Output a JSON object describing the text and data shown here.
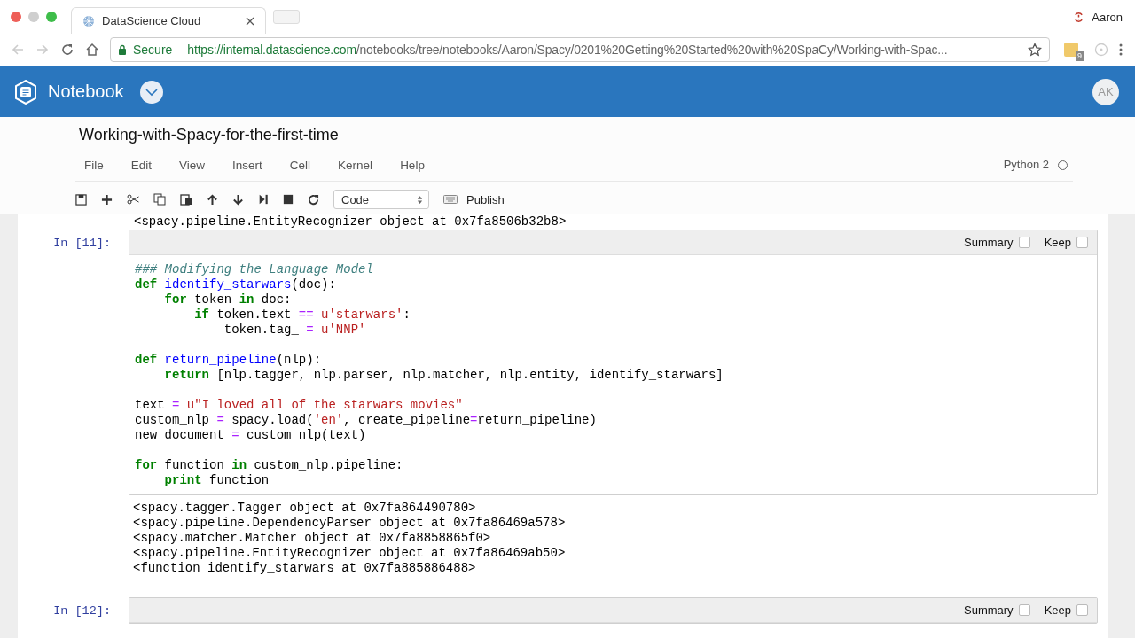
{
  "browser": {
    "tab_title": "DataScience Cloud",
    "user_name": "Aaron",
    "secure_label": "Secure",
    "url_host": "https://internal.datascience.com",
    "url_path": "/notebooks/tree/notebooks/Aaron/Spacy/0201%20Getting%20Started%20with%20SpaCy/Working-with-Spac...",
    "extension_badge": "9"
  },
  "header": {
    "app_name": "Notebook",
    "avatar": "AK"
  },
  "notebook": {
    "title": "Working-with-Spacy-for-the-first-time",
    "menu": [
      "File",
      "Edit",
      "View",
      "Insert",
      "Cell",
      "Kernel",
      "Help"
    ],
    "kernel": "Python 2",
    "cell_type": "Code",
    "publish": "Publish"
  },
  "partial_output": "<spacy.pipeline.EntityRecognizer object at 0x7fa8506b32b8>",
  "cells": [
    {
      "prompt": "In [11]:",
      "summary_label": "Summary",
      "summary_checked": false,
      "keep_label": "Keep",
      "keep_checked": false,
      "code": [
        {
          "kind": "code",
          "tokens": [
            {
              "kind": "comment",
              "t": "### Modifying the Language Model"
            }
          ]
        },
        {
          "kind": "code",
          "tokens": [
            {
              "kind": "kw",
              "t": "def"
            },
            {
              "kind": "fn",
              "t": " identify_starwars"
            },
            {
              "kind": "plain",
              "t": "(doc):"
            }
          ]
        },
        {
          "kind": "code",
          "tokens": [
            {
              "kind": "kw",
              "t": "    for"
            },
            {
              "kind": "plain",
              "t": " token "
            },
            {
              "kind": "kw",
              "t": "in"
            },
            {
              "kind": "plain",
              "t": " doc:"
            }
          ]
        },
        {
          "kind": "code",
          "tokens": [
            {
              "kind": "kw",
              "t": "        if"
            },
            {
              "kind": "plain",
              "t": " token.text "
            },
            {
              "kind": "op",
              "t": "=="
            },
            {
              "kind": "str",
              "t": " u'starwars'"
            },
            {
              "kind": "plain",
              "t": ":"
            }
          ]
        },
        {
          "kind": "code",
          "tokens": [
            {
              "kind": "plain",
              "t": "            token.tag_ "
            },
            {
              "kind": "op",
              "t": "="
            },
            {
              "kind": "str",
              "t": " u'NNP'"
            }
          ]
        },
        {
          "kind": "blank"
        },
        {
          "kind": "code",
          "tokens": [
            {
              "kind": "kw",
              "t": "def"
            },
            {
              "kind": "fn",
              "t": " return_pipeline"
            },
            {
              "kind": "plain",
              "t": "(nlp):"
            }
          ]
        },
        {
          "kind": "code",
          "tokens": [
            {
              "kind": "kw",
              "t": "    return"
            },
            {
              "kind": "plain",
              "t": " [nlp.tagger, nlp.parser, nlp.matcher, nlp.entity, identify_starwars]"
            }
          ]
        },
        {
          "kind": "blank"
        },
        {
          "kind": "code",
          "tokens": [
            {
              "kind": "plain",
              "t": "text "
            },
            {
              "kind": "op",
              "t": "="
            },
            {
              "kind": "str",
              "t": " u\"I loved all of the starwars movies\""
            }
          ]
        },
        {
          "kind": "code",
          "tokens": [
            {
              "kind": "plain",
              "t": "custom_nlp "
            },
            {
              "kind": "op",
              "t": "="
            },
            {
              "kind": "plain",
              "t": " spacy.load("
            },
            {
              "kind": "str",
              "t": "'en'"
            },
            {
              "kind": "plain",
              "t": ", create_pipeline"
            },
            {
              "kind": "op",
              "t": "="
            },
            {
              "kind": "plain",
              "t": "return_pipeline)"
            }
          ]
        },
        {
          "kind": "code",
          "tokens": [
            {
              "kind": "plain",
              "t": "new_document "
            },
            {
              "kind": "op",
              "t": "="
            },
            {
              "kind": "plain",
              "t": " custom_nlp(text)"
            }
          ]
        },
        {
          "kind": "blank"
        },
        {
          "kind": "code",
          "tokens": [
            {
              "kind": "kw",
              "t": "for"
            },
            {
              "kind": "plain",
              "t": " function "
            },
            {
              "kind": "kw",
              "t": "in"
            },
            {
              "kind": "plain",
              "t": " custom_nlp.pipeline:"
            }
          ]
        },
        {
          "kind": "code",
          "tokens": [
            {
              "kind": "kw",
              "t": "    print"
            },
            {
              "kind": "plain",
              "t": " function"
            }
          ]
        }
      ],
      "output": [
        "<spacy.tagger.Tagger object at 0x7fa864490780>",
        "<spacy.pipeline.DependencyParser object at 0x7fa86469a578>",
        "<spacy.matcher.Matcher object at 0x7fa8858865f0>",
        "<spacy.pipeline.EntityRecognizer object at 0x7fa86469ab50>",
        "<function identify_starwars at 0x7fa885886488>"
      ]
    },
    {
      "prompt": "In [12]:",
      "summary_label": "Summary",
      "summary_checked": false,
      "keep_label": "Keep",
      "keep_checked": false
    }
  ]
}
